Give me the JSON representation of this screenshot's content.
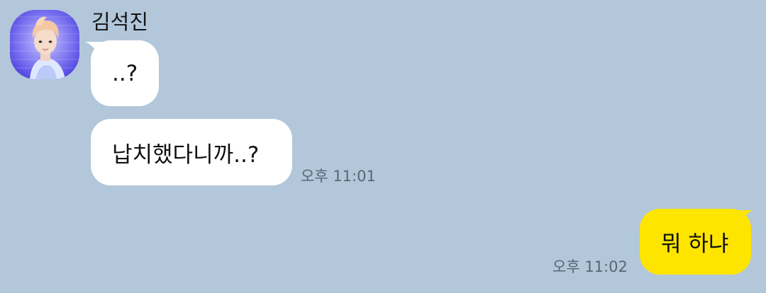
{
  "contact": {
    "name": "김석진",
    "avatar_icon": "profile-photo"
  },
  "messages": [
    {
      "direction": "incoming",
      "text": "..?",
      "time": ""
    },
    {
      "direction": "incoming",
      "text": "납치했다니까..?",
      "time": "오후 11:01"
    },
    {
      "direction": "outgoing",
      "text": "뭐 하냐",
      "time": "오후 11:02"
    }
  ],
  "colors": {
    "background": "#b2c7da",
    "incoming_bubble": "#ffffff",
    "outgoing_bubble": "#fee500",
    "timestamp": "#5a6672"
  }
}
